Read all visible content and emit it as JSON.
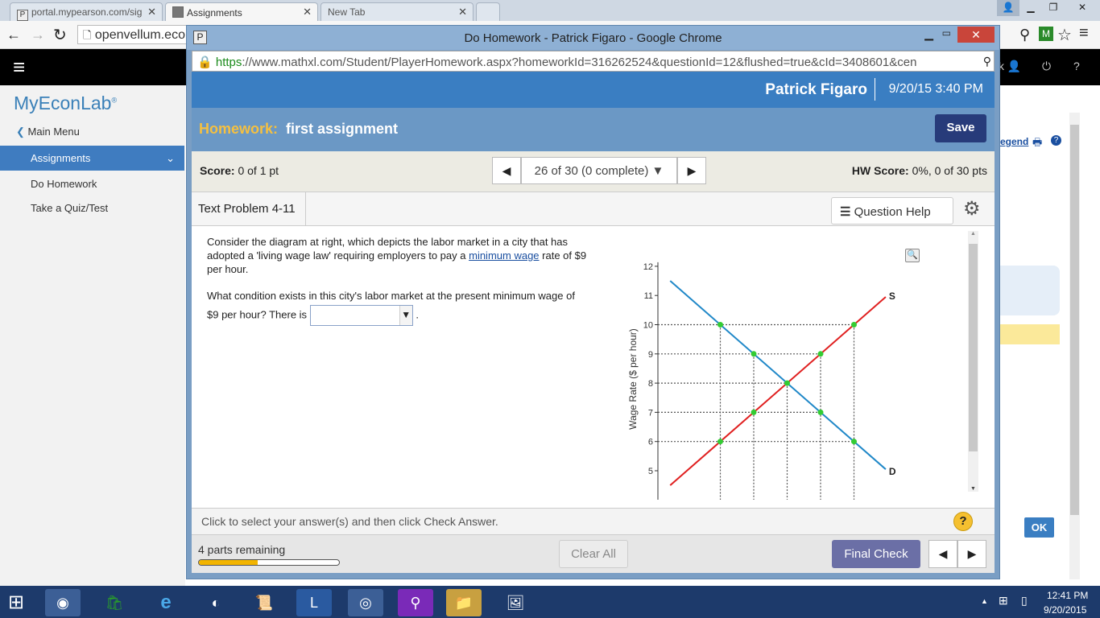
{
  "outer_tabs": [
    {
      "label": "portal.mypearson.com/sig",
      "favicon": "P"
    },
    {
      "label": "Assignments"
    },
    {
      "label": "New Tab"
    }
  ],
  "outer_url": "openvellum.eco",
  "brand": "MyEconLab",
  "sidebar": {
    "main_menu": "Main Menu",
    "active": "Assignments",
    "items": [
      "Do Homework",
      "Take a Quiz/Test"
    ]
  },
  "behind_panel": {
    "legend_link": "egend",
    "ok_button": "OK"
  },
  "popup": {
    "window_title": "Do Homework - Patrick Figaro - Google Chrome",
    "url_https": "https",
    "url_rest": "://www.mathxl.com/Student/PlayerHomework.aspx?homeworkId=316262524&questionId=12&flushed=true&cId=3408601&cen",
    "user_name": "Patrick Figaro",
    "datetime": "9/20/15 3:40 PM",
    "hw_label": "Homework:",
    "hw_name": "first assignment",
    "save": "Save",
    "score_label": "Score:",
    "score_value": "0 of 1 pt",
    "nav_text": "26 of 30 (0 complete)",
    "hw_score_label": "HW Score:",
    "hw_score_value": "0%, 0 of 30 pts",
    "problem_tab": "Text Problem 4-11",
    "question_help": "Question Help",
    "question_p1_before": "Consider the diagram at right, which depicts the labor market in a city that has adopted a 'living wage law' requiring employers to pay a",
    "question_link": "minimum wage",
    "question_p1_after": "rate of $9 per hour.",
    "question_p2": "What condition exists in this city's labor market at the present minimum wage of $9 per hour? There is",
    "question_p2_end": ".",
    "footer_instruction": "Click to select your answer(s) and then click Check Answer.",
    "parts_remaining": "4 parts remaining",
    "progress": 0.42,
    "clear_all": "Clear All",
    "final_check": "Final Check"
  },
  "chart_data": {
    "type": "line",
    "ylabel": "Wage Rate ($ per hour)",
    "y_ticks": [
      "5",
      "6",
      "7",
      "8",
      "9",
      "10",
      "11",
      "12"
    ],
    "ylim": [
      4.8,
      12
    ],
    "series": [
      {
        "name": "S",
        "color": "#e02020",
        "x": [
          1,
          2,
          3,
          4,
          5,
          6
        ],
        "y": [
          5,
          6,
          7,
          8,
          9,
          10
        ],
        "label_y": 11
      },
      {
        "name": "D",
        "color": "#2088c8",
        "x": [
          1,
          2,
          3,
          4,
          5,
          6
        ],
        "y": [
          11,
          10,
          9,
          8,
          7,
          6
        ],
        "label_y": 5
      }
    ],
    "points": [
      {
        "x": 2,
        "y": 10
      },
      {
        "x": 6,
        "y": 10
      },
      {
        "x": 3,
        "y": 9
      },
      {
        "x": 5,
        "y": 9
      },
      {
        "x": 4,
        "y": 8
      },
      {
        "x": 3,
        "y": 7
      },
      {
        "x": 5,
        "y": 7
      },
      {
        "x": 2,
        "y": 6
      },
      {
        "x": 6,
        "y": 6
      }
    ],
    "dotted_h": [
      10,
      9,
      8,
      7,
      6
    ],
    "dotted_v": [
      2,
      3,
      4,
      5,
      6
    ],
    "point_color": "#33cc33"
  },
  "taskbar": {
    "time": "12:41 PM",
    "date": "9/20/2015"
  }
}
